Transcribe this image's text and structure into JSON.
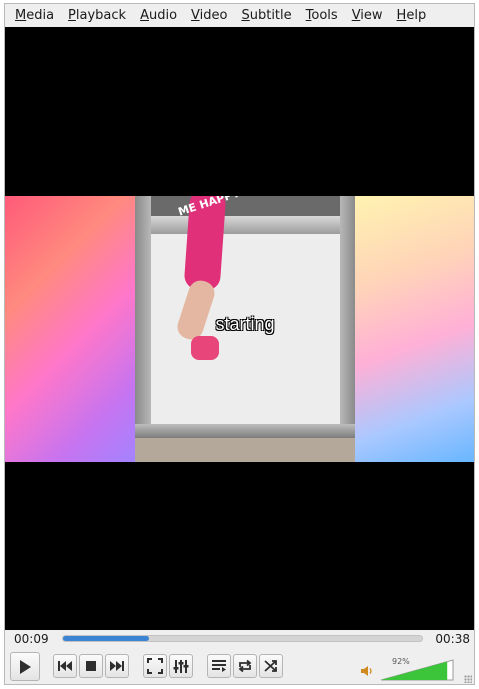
{
  "menu": {
    "items": [
      {
        "accel": "M",
        "rest": "edia"
      },
      {
        "accel": "P",
        "rest": "layback"
      },
      {
        "accel": "A",
        "rest": "udio"
      },
      {
        "accel": "V",
        "rest": "ideo"
      },
      {
        "accel": "S",
        "rest": "ubtitle"
      },
      {
        "accel": "T",
        "rest": "ools"
      },
      {
        "accel": "V",
        "rest": "iew"
      },
      {
        "accel": "H",
        "rest": "elp"
      }
    ]
  },
  "video": {
    "subtitle_text": "starting",
    "sleeve_text": "ME HAPPY"
  },
  "seek": {
    "elapsed": "00:09",
    "total": "00:38",
    "progress_fraction": 0.24
  },
  "controls": {
    "buttons": [
      "play-icon",
      "previous-icon",
      "stop-icon",
      "next-icon",
      "fullscreen-icon",
      "extended-settings-icon",
      "playlist-icon",
      "loop-icon",
      "shuffle-icon"
    ],
    "volume_percent_label": "92%",
    "volume_fraction": 0.92,
    "colors": {
      "accent": "#3b84d4",
      "volume": "#3cc43a"
    }
  }
}
